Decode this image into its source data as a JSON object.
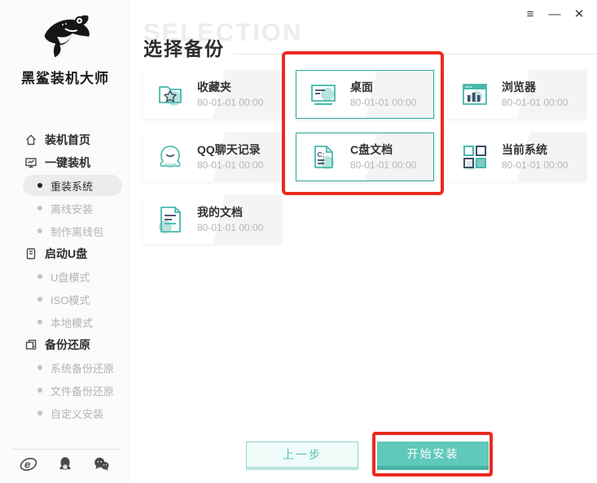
{
  "window_controls": {
    "menu": "≡",
    "minimize": "—",
    "close": "✕"
  },
  "colors": {
    "accent": "#46b8ac",
    "accent_dark": "#49b2a5",
    "accent_light": "#b7e3dc",
    "navy": "#3f4e66",
    "annotation_red": "#ea2b1f",
    "inactive_gray": "#b3b3b3"
  },
  "sidebar": {
    "logo_title": "黑鲨装机大师",
    "items": [
      {
        "label": "装机首页",
        "type": "section",
        "icon": "home-icon"
      },
      {
        "label": "一键装机",
        "type": "section",
        "icon": "monitor-icon"
      },
      {
        "label": "重装系统",
        "type": "sub",
        "selected": true
      },
      {
        "label": "离线安装",
        "type": "sub",
        "selected": false
      },
      {
        "label": "制作离线包",
        "type": "sub",
        "selected": false
      },
      {
        "label": "启动U盘",
        "type": "section",
        "icon": "usb-icon"
      },
      {
        "label": "U盘模式",
        "type": "sub",
        "selected": false
      },
      {
        "label": "ISO模式",
        "type": "sub",
        "selected": false
      },
      {
        "label": "本地模式",
        "type": "sub",
        "selected": false
      },
      {
        "label": "备份还原",
        "type": "section",
        "icon": "restore-icon"
      },
      {
        "label": "系统备份还原",
        "type": "sub",
        "selected": false
      },
      {
        "label": "文件备份还原",
        "type": "sub",
        "selected": false
      },
      {
        "label": "自定义安装",
        "type": "sub",
        "selected": false
      }
    ],
    "footer_icons": [
      "ie-icon",
      "qq-icon",
      "wechat-icon"
    ]
  },
  "header": {
    "ghost": "SELECTION",
    "title": "选择备份"
  },
  "cards": [
    {
      "title": "收藏夹",
      "date": "80-01-01 00:00",
      "icon": "favorites-folder-icon",
      "selected": false
    },
    {
      "title": "桌面",
      "date": "80-01-01 00:00",
      "icon": "desktop-icon",
      "selected": true
    },
    {
      "title": "浏览器",
      "date": "80-01-01 00:00",
      "icon": "browser-icon",
      "selected": false
    },
    {
      "title": "QQ聊天记录",
      "date": "80-01-01 00:00",
      "icon": "qq-chat-icon",
      "selected": false
    },
    {
      "title": "C盘文档",
      "date": "80-01-01 00:00",
      "icon": "c-drive-doc-icon",
      "selected": true
    },
    {
      "title": "当前系统",
      "date": "80-01-01 00:00",
      "icon": "current-system-icon",
      "selected": false
    },
    {
      "title": "我的文档",
      "date": "80-01-01 00:00",
      "icon": "my-documents-icon",
      "selected": false
    }
  ],
  "icon_labels": {
    "c_drive": "C:"
  },
  "footer": {
    "back_label": "上一步",
    "start_label": "开始安装"
  }
}
